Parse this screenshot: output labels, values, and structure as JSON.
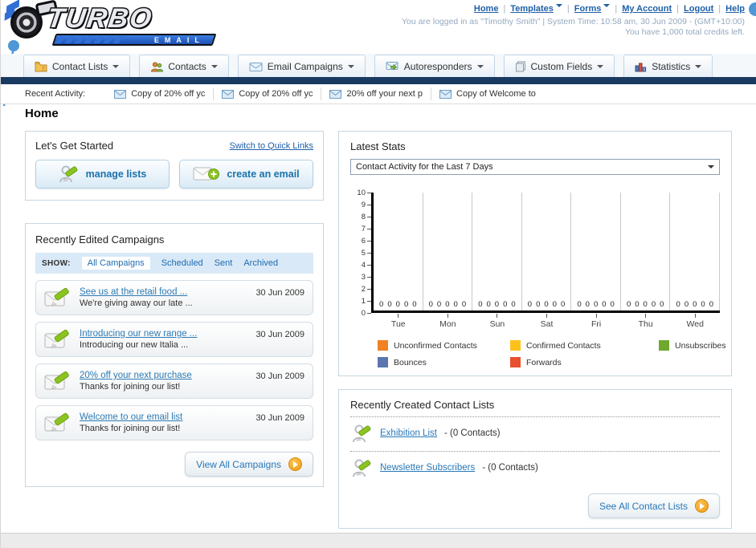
{
  "header": {
    "logo_title": "TURBO",
    "logo_subtitle": "EMAIL",
    "nav_links": [
      {
        "label": "Home",
        "has_caret": false
      },
      {
        "label": "Templates",
        "has_caret": true
      },
      {
        "label": "Forms",
        "has_caret": true
      },
      {
        "label": "My Account",
        "has_caret": false
      },
      {
        "label": "Logout",
        "has_caret": false
      },
      {
        "label": "Help",
        "has_caret": false
      }
    ],
    "login_status": "You are logged in as \"Timothy Smith\" | System Time: 10:58 am, 30 Jun 2009 - (GMT+10:00)",
    "credits": "You have 1,000 total credits left."
  },
  "tabs": [
    {
      "label": "Contact Lists"
    },
    {
      "label": "Contacts"
    },
    {
      "label": "Email Campaigns"
    },
    {
      "label": "Autoresponders"
    },
    {
      "label": "Custom Fields"
    },
    {
      "label": "Statistics"
    }
  ],
  "recent_activity": {
    "label": "Recent Activity:",
    "items": [
      "Copy of 20% off yc",
      "Copy of 20% off yc",
      "20% off your next p",
      "Copy of Welcome to"
    ]
  },
  "page_title": "Home",
  "get_started": {
    "title": "Let's Get Started",
    "switch_link": "Switch to Quick Links",
    "manage_lists_label": "manage lists",
    "create_email_label": "create an email"
  },
  "campaigns": {
    "title": "Recently Edited Campaigns",
    "show_label": "SHOW:",
    "filters": [
      "All Campaigns",
      "Scheduled",
      "Sent",
      "Archived"
    ],
    "active_filter": "All Campaigns",
    "items": [
      {
        "title": "See us at the retail food ...",
        "subtitle": "We're giving away our late ...",
        "date": "30 Jun 2009"
      },
      {
        "title": "Introducing our new range ...",
        "subtitle": "Introducing our new Italia ...",
        "date": "30 Jun 2009"
      },
      {
        "title": "20% off your next purchase",
        "subtitle": "Thanks for joining our list!",
        "date": "30 Jun 2009"
      },
      {
        "title": "Welcome to our email list",
        "subtitle": "Thanks for joining our list!",
        "date": "30 Jun 2009"
      }
    ],
    "view_all_label": "View All Campaigns"
  },
  "latest_stats": {
    "title": "Latest Stats",
    "dropdown_value": "Contact Activity for the Last 7 Days"
  },
  "chart_data": {
    "type": "bar",
    "title": "Contact Activity for the Last 7 Days",
    "categories": [
      "Tue",
      "Mon",
      "Sun",
      "Sat",
      "Fri",
      "Thu",
      "Wed"
    ],
    "series": [
      {
        "name": "Unconfirmed Contacts",
        "color": "#f08222",
        "values": [
          0,
          0,
          0,
          0,
          0,
          0,
          0
        ]
      },
      {
        "name": "Confirmed Contacts",
        "color": "#fcc21b",
        "values": [
          0,
          0,
          0,
          0,
          0,
          0,
          0
        ]
      },
      {
        "name": "Unsubscribes",
        "color": "#6fa82d",
        "values": [
          0,
          0,
          0,
          0,
          0,
          0,
          0
        ]
      },
      {
        "name": "Bounces",
        "color": "#5b76ae",
        "values": [
          0,
          0,
          0,
          0,
          0,
          0,
          0
        ]
      },
      {
        "name": "Forwards",
        "color": "#e8502f",
        "values": [
          0,
          0,
          0,
          0,
          0,
          0,
          0
        ]
      }
    ],
    "ylim": [
      0,
      10
    ],
    "yticks": [
      0,
      1,
      2,
      3,
      4,
      5,
      6,
      7,
      8,
      9,
      10
    ],
    "grid": true,
    "legend_position": "bottom",
    "value_labels_shown": true
  },
  "contact_lists": {
    "title": "Recently Created Contact Lists",
    "items": [
      {
        "name": "Exhibition List",
        "detail": "- (0 Contacts)"
      },
      {
        "name": "Newsletter Subscribers",
        "detail": "- (0 Contacts)"
      }
    ],
    "see_all_label": "See All Contact Lists"
  }
}
